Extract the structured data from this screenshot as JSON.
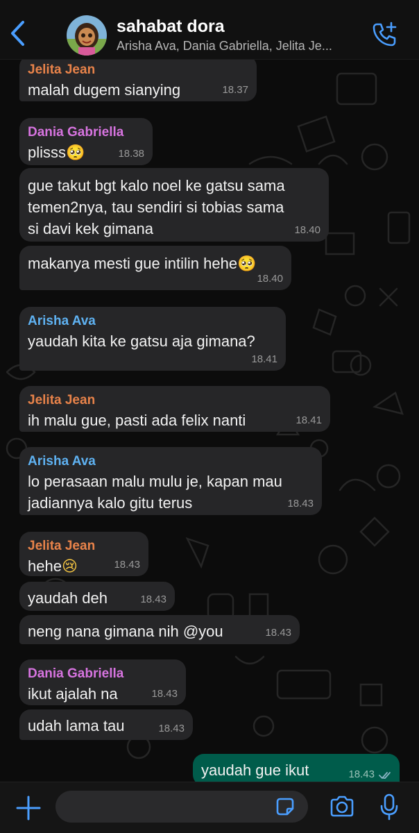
{
  "header": {
    "title": "sahabat dora",
    "subtitle": "Arisha Ava, Dania Gabriella, Jelita Je..."
  },
  "colors": {
    "accent": "#4a9eff",
    "jelita": "#e8834a",
    "dania": "#d774e0",
    "arisha": "#5fb2f2",
    "outgoing_bubble": "#005c4b",
    "incoming_bubble": "#262628"
  },
  "icons": [
    "back-chevron-icon",
    "add-call-icon",
    "plus-icon",
    "sticker-icon",
    "camera-icon",
    "mic-icon",
    "double-check-icon"
  ],
  "messages": [
    {
      "sender": "Jelita Jean",
      "text": "malah dugem sianying",
      "time": "18.37"
    },
    {
      "sender": "Dania Gabriella",
      "text": "plisss",
      "emoji": "🥺",
      "time": "18.38"
    },
    {
      "text_lines": [
        "gue takut bgt kalo noel ke gatsu sama",
        "temen2nya, tau sendiri si tobias sama",
        "si davi kek gimana"
      ],
      "time": "18.40"
    },
    {
      "text": "makanya mesti gue intilin hehe",
      "emoji": "🥺",
      "time": "18.40"
    },
    {
      "sender": "Arisha Ava",
      "text": "yaudah kita ke gatsu aja gimana?",
      "time": "18.41"
    },
    {
      "sender": "Jelita Jean",
      "text": "ih malu gue, pasti ada felix nanti",
      "time": "18.41"
    },
    {
      "sender": "Arisha Ava",
      "text_lines": [
        "lo perasaan malu mulu je, kapan mau",
        "jadiannya kalo gitu terus"
      ],
      "time": "18.43"
    },
    {
      "sender": "Jelita Jean",
      "text": "hehe",
      "emoji": "😢",
      "time": "18.43"
    },
    {
      "text": "yaudah deh",
      "time": "18.43"
    },
    {
      "text": "neng nana gimana nih @you",
      "time": "18.43"
    },
    {
      "sender": "Dania Gabriella",
      "text": "ikut ajalah na",
      "time": "18.43"
    },
    {
      "text": "udah lama tau",
      "time": "18.43"
    },
    {
      "text": "yaudah gue ikut",
      "time": "18.43",
      "outgoing": true
    }
  ],
  "composer": {
    "value": "",
    "placeholder": ""
  }
}
